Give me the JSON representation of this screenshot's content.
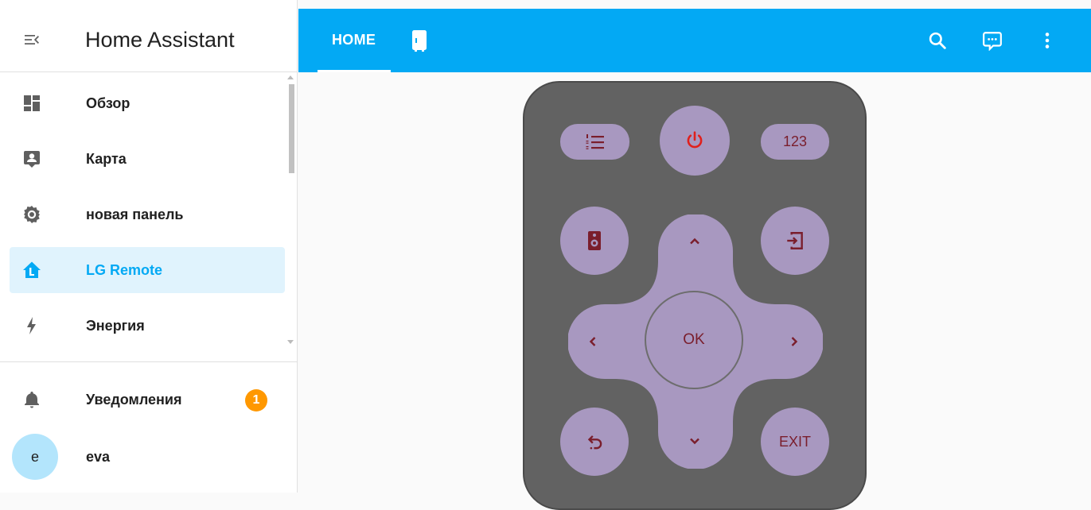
{
  "app": {
    "title": "Home Assistant"
  },
  "sidebar": {
    "items": [
      {
        "label": "Обзор",
        "icon": "dashboard-icon"
      },
      {
        "label": "Карта",
        "icon": "account-box-icon"
      },
      {
        "label": "новая панель",
        "icon": "gear-icon"
      },
      {
        "label": "LG Remote",
        "icon": "home-l-icon",
        "active": true
      },
      {
        "label": "Энергия",
        "icon": "lightning-icon"
      }
    ],
    "notifications": {
      "label": "Уведомления",
      "count": "1"
    },
    "user": {
      "name": "eva",
      "initial": "e"
    }
  },
  "topbar": {
    "tabs": [
      {
        "label": "HOME"
      },
      {
        "icon": "fridge-icon"
      }
    ],
    "actions": [
      "search-icon",
      "assist-chat-icon",
      "more-vert-icon"
    ]
  },
  "remote": {
    "buttons": {
      "numbers_label": "123",
      "ok_label": "OK",
      "exit_label": "EXIT"
    }
  },
  "colors": {
    "accent": "#03a9f4",
    "active_bg": "#e0f3fd",
    "badge": "#ff9800",
    "remote_body": "#626262",
    "remote_button": "#a898c0",
    "remote_icon": "#7a1e2c",
    "power_icon": "#e0201c"
  }
}
